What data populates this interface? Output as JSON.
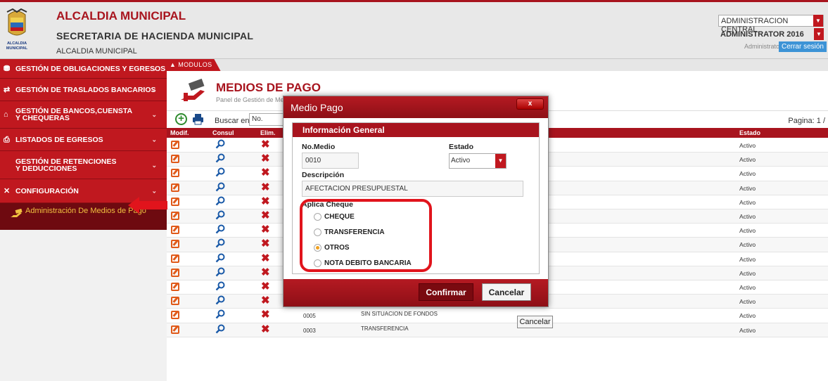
{
  "header": {
    "title": "ALCALDIA MUNICIPAL",
    "subtitle": "SECRETARIA DE HACIENDA MUNICIPAL",
    "small": "ALCALDIA MUNICIPAL",
    "logo_text": "ALCALDIA MUNICIPAL",
    "entity_select": "ADMINISTRACION CENTRAL",
    "user_select": "ADMINISTRATOR 2016",
    "user_role": "Administrator",
    "logout_label": "Cerrar sesión"
  },
  "sidebar": {
    "items": [
      {
        "label": "GESTIÓN DE OBLIGACIONES Y EGRESOS",
        "icon": "coins-icon"
      },
      {
        "label": "GESTIÓN DE TRASLADOS BANCARIOS",
        "icon": "transfer-icon"
      },
      {
        "label": "GESTIÓN DE BANCOS,CUENSTA Y CHEQUERAS",
        "icon": "bank-icon"
      },
      {
        "label": "LISTADOS DE EGRESOS",
        "icon": "print-icon"
      },
      {
        "label": "GESTIÓN DE RETENCIONES Y DEDUCCIONES",
        "icon": "none"
      },
      {
        "label": "CONFIGURACIÓN",
        "icon": "tools-icon"
      }
    ],
    "sub_item": "Administración De Medios de Pago"
  },
  "main": {
    "modulos_label": "MODULOS",
    "page_title": "MEDIOS DE PAGO",
    "page_subtitle": "Panel de Gestión de Med",
    "search_label": "Buscar en",
    "search_value": "No.",
    "pagination": "Pagina: 1 /",
    "columns": {
      "modif": "Modif.",
      "consul": "Consul",
      "elim": "Elim.",
      "estado": "Estado"
    },
    "rows": [
      {
        "code": "",
        "desc": "",
        "estado": "Activo"
      },
      {
        "code": "",
        "desc": "",
        "estado": "Activo"
      },
      {
        "code": "",
        "desc": "",
        "estado": "Activo"
      },
      {
        "code": "",
        "desc": "",
        "estado": "Activo"
      },
      {
        "code": "",
        "desc": "",
        "estado": "Activo"
      },
      {
        "code": "",
        "desc": "",
        "estado": "Activo"
      },
      {
        "code": "",
        "desc": "",
        "estado": "Activo"
      },
      {
        "code": "",
        "desc": "",
        "estado": "Activo"
      },
      {
        "code": "",
        "desc": "",
        "estado": "Activo"
      },
      {
        "code": "",
        "desc": "",
        "estado": "Activo"
      },
      {
        "code": "",
        "desc": "",
        "estado": "Activo"
      },
      {
        "code": "",
        "desc": "",
        "estado": "Activo"
      },
      {
        "code": "0005",
        "desc": "SIN SITUACION DE FONDOS",
        "estado": "Activo"
      },
      {
        "code": "0003",
        "desc": "TRANSFERENCIA",
        "estado": "Activo"
      }
    ],
    "background_cancel": "Cancelar"
  },
  "modal": {
    "title": "Medio Pago",
    "close_label": "x",
    "section_title": "Información General",
    "no_medio_label": "No.Medio",
    "no_medio_value": "0010",
    "estado_label": "Estado",
    "estado_value": "Activo",
    "descripcion_label": "Descripción",
    "descripcion_value": "AFECTACION PRESUPUESTAL",
    "aplica_label": "Aplica Cheque",
    "options": [
      {
        "label": "CHEQUE",
        "checked": false
      },
      {
        "label": "TRANSFERENCIA",
        "checked": false
      },
      {
        "label": "OTROS",
        "checked": true
      },
      {
        "label": "NOTA DEBITO BANCARIA",
        "checked": false
      }
    ],
    "confirm_label": "Confirmar",
    "cancel_label": "Cancelar"
  },
  "colors": {
    "brand": "#c0181f",
    "dark_red": "#a8141e",
    "highlight": "#e1141c",
    "radio_on": "#f0a020"
  }
}
